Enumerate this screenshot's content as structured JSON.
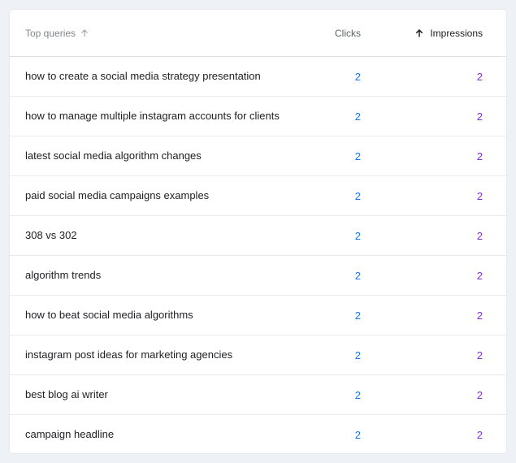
{
  "header": {
    "query_label": "Top queries",
    "clicks_label": "Clicks",
    "impressions_label": "Impressions"
  },
  "rows": [
    {
      "query": "how to create a social media strategy presentation",
      "clicks": "2",
      "impressions": "2"
    },
    {
      "query": "how to manage multiple instagram accounts for clients",
      "clicks": "2",
      "impressions": "2"
    },
    {
      "query": "latest social media algorithm changes",
      "clicks": "2",
      "impressions": "2"
    },
    {
      "query": "paid social media campaigns examples",
      "clicks": "2",
      "impressions": "2"
    },
    {
      "query": "308 vs 302",
      "clicks": "2",
      "impressions": "2"
    },
    {
      "query": "algorithm trends",
      "clicks": "2",
      "impressions": "2"
    },
    {
      "query": "how to beat social media algorithms",
      "clicks": "2",
      "impressions": "2"
    },
    {
      "query": "instagram post ideas for marketing agencies",
      "clicks": "2",
      "impressions": "2"
    },
    {
      "query": "best blog ai writer",
      "clicks": "2",
      "impressions": "2"
    },
    {
      "query": "campaign headline",
      "clicks": "2",
      "impressions": "2"
    }
  ],
  "colors": {
    "clicks": "#1a73e8",
    "impressions": "#8430ce"
  },
  "icons": {
    "query_sort": "arrow-up-icon",
    "impressions_sort": "arrow-up-icon"
  }
}
